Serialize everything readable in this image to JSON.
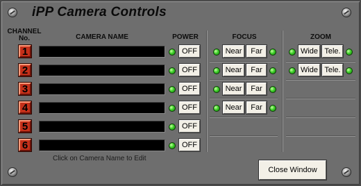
{
  "title": "iPP Camera Controls",
  "headers": {
    "channel": "CHANNEL No.",
    "camera_name": "CAMERA NAME",
    "power": "POWER",
    "focus": "FOCUS",
    "zoom": "ZOOM"
  },
  "channels": [
    {
      "number": "1",
      "camera_name": "",
      "power_label": "OFF"
    },
    {
      "number": "2",
      "camera_name": "",
      "power_label": "OFF"
    },
    {
      "number": "3",
      "camera_name": "",
      "power_label": "OFF"
    },
    {
      "number": "4",
      "camera_name": "",
      "power_label": "OFF"
    },
    {
      "number": "5",
      "camera_name": "",
      "power_label": "OFF"
    },
    {
      "number": "6",
      "camera_name": "",
      "power_label": "OFF"
    }
  ],
  "focus_rows": [
    {
      "near_label": "Near",
      "far_label": "Far"
    },
    {
      "near_label": "Near",
      "far_label": "Far"
    },
    {
      "near_label": "Near",
      "far_label": "Far"
    },
    {
      "near_label": "Near",
      "far_label": "Far"
    }
  ],
  "zoom_rows": [
    {
      "wide_label": "Wide",
      "tele_label": "Tele."
    },
    {
      "wide_label": "Wide",
      "tele_label": "Tele."
    }
  ],
  "hint": "Click on Camera Name to Edit",
  "close_label": "Close Window",
  "colors": {
    "panel": "#6e6e6e",
    "channel_badge": "#c4301a",
    "led_on": "#3ed02a",
    "name_field": "#000000"
  }
}
